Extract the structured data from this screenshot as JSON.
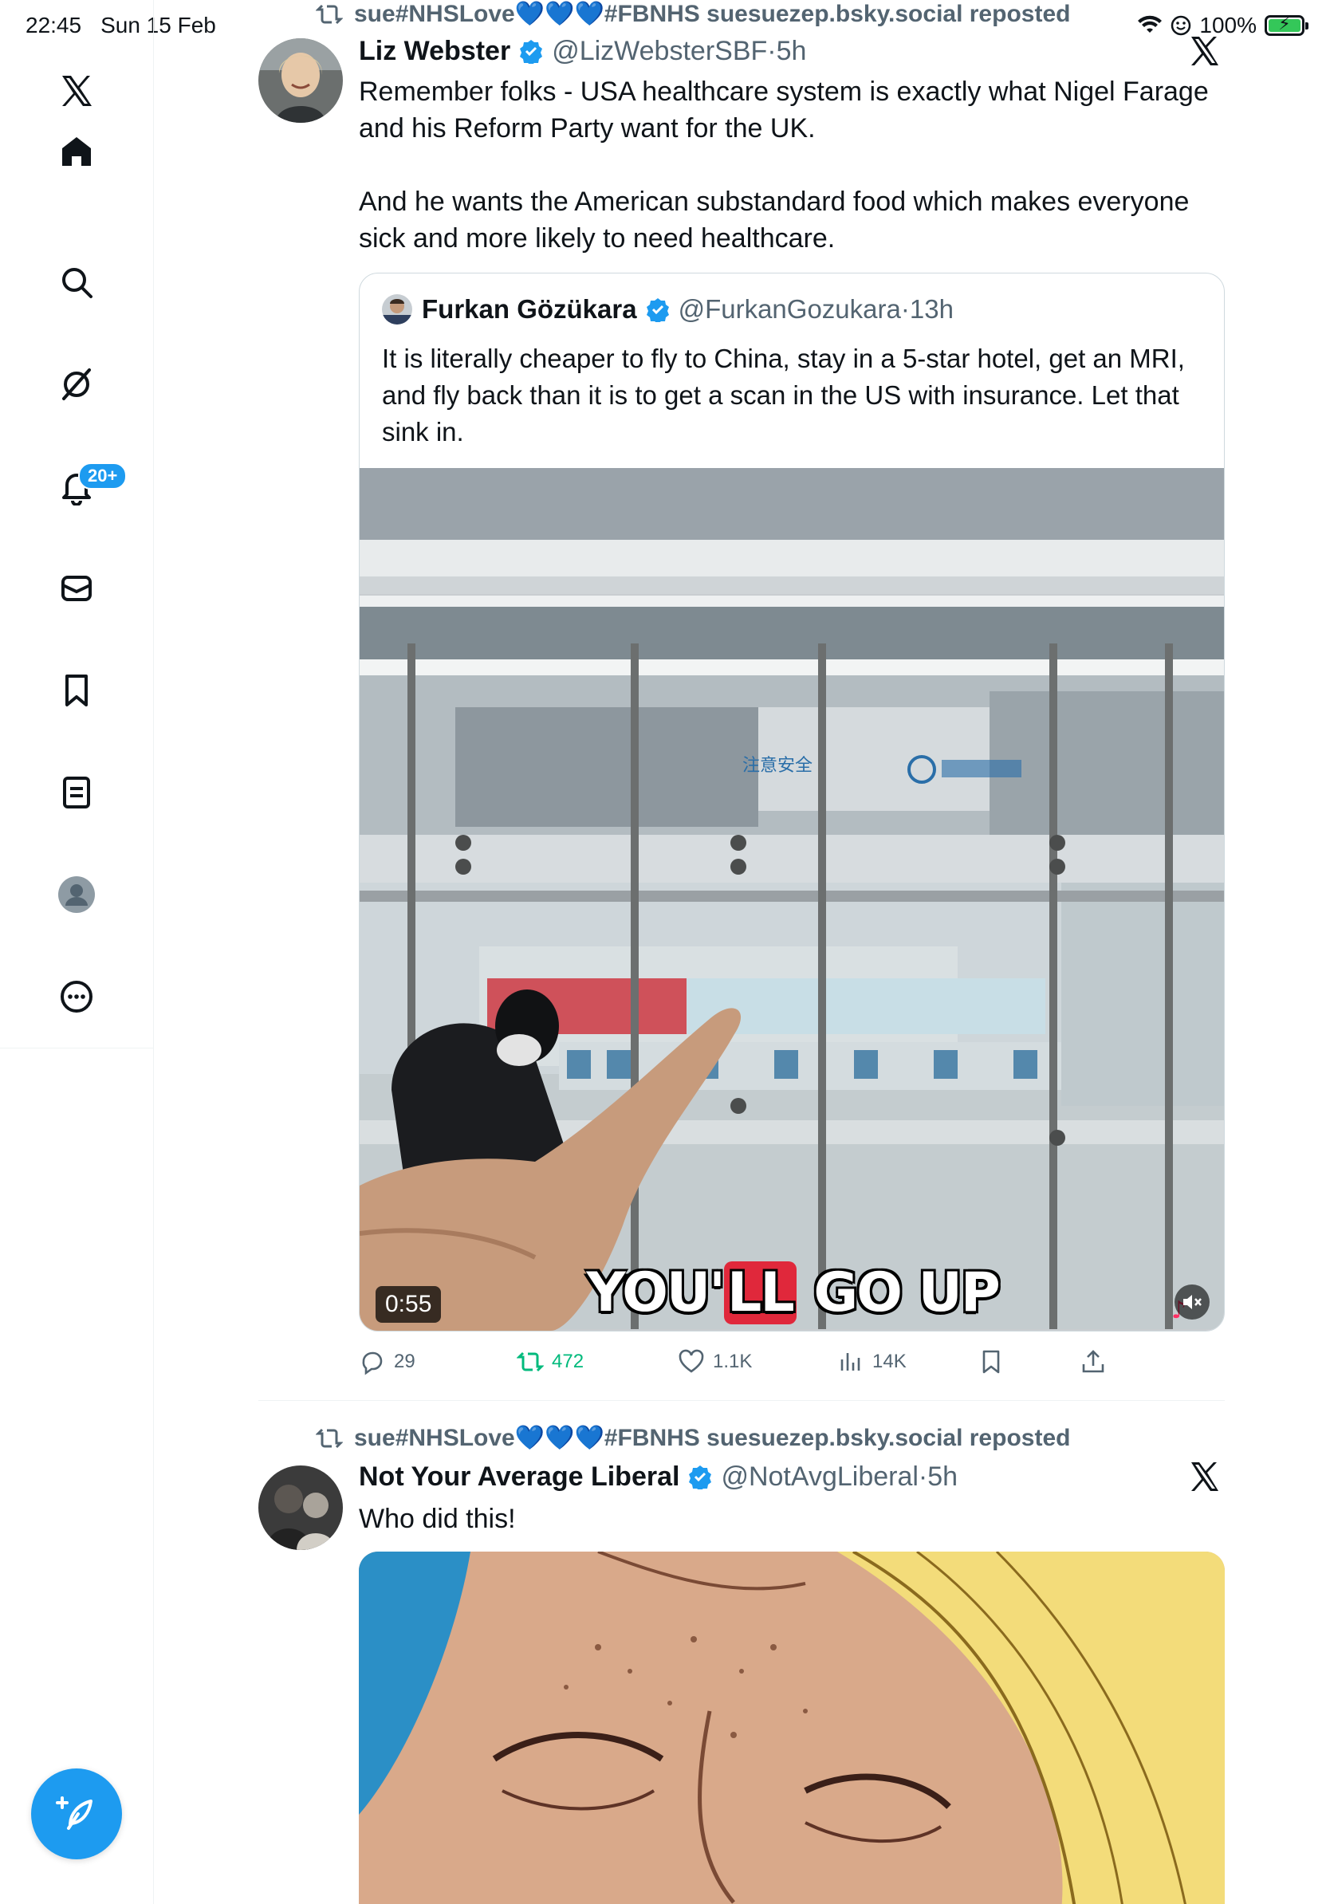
{
  "status_bar": {
    "time": "22:45",
    "date": "Sun 15 Feb",
    "battery": "100%"
  },
  "sidebar": {
    "notifications_badge": "20+",
    "items": [
      "x-logo",
      "home",
      "explore",
      "grok",
      "notifications",
      "messages",
      "bookmarks",
      "lists",
      "profile",
      "more"
    ]
  },
  "colors": {
    "accent": "#1d9bf0",
    "muted": "#536471",
    "retweet_active": "#00ba7c"
  },
  "posts": [
    {
      "repost_text": "sue#NHSLove💙💙💙#FBNHS suesuezep.bsky.social reposted",
      "author": "Liz Webster",
      "handle": "@LizWebsterSBF",
      "time": "5h",
      "text": "Remember folks - USA healthcare system is exactly what Nigel Farage and his Reform Party want for the UK.\n\nAnd he wants the American substandard food which makes everyone sick and more likely to need healthcare.",
      "quote": {
        "author": "Furkan Gözükara",
        "handle": "@FurkanGozukara",
        "time": "13h",
        "text": "It is literally cheaper to fly to China, stay in a 5-star hotel, get an MRI, and fly back than it is to get a scan in the US with insurance. Let that sink in.",
        "video_duration": "0:55",
        "video_caption_pre": "YOU'",
        "video_caption_hl": "LL",
        "video_caption_post": " GO UP"
      },
      "actions": {
        "replies": "29",
        "reposts": "472",
        "likes": "1.1K",
        "views": "14K"
      }
    },
    {
      "repost_text": "sue#NHSLove💙💙💙#FBNHS suesuezep.bsky.social reposted",
      "author": "Not Your Average Liberal",
      "handle": "@NotAvgLiberal",
      "time": "5h",
      "text": "Who did this!"
    }
  ]
}
